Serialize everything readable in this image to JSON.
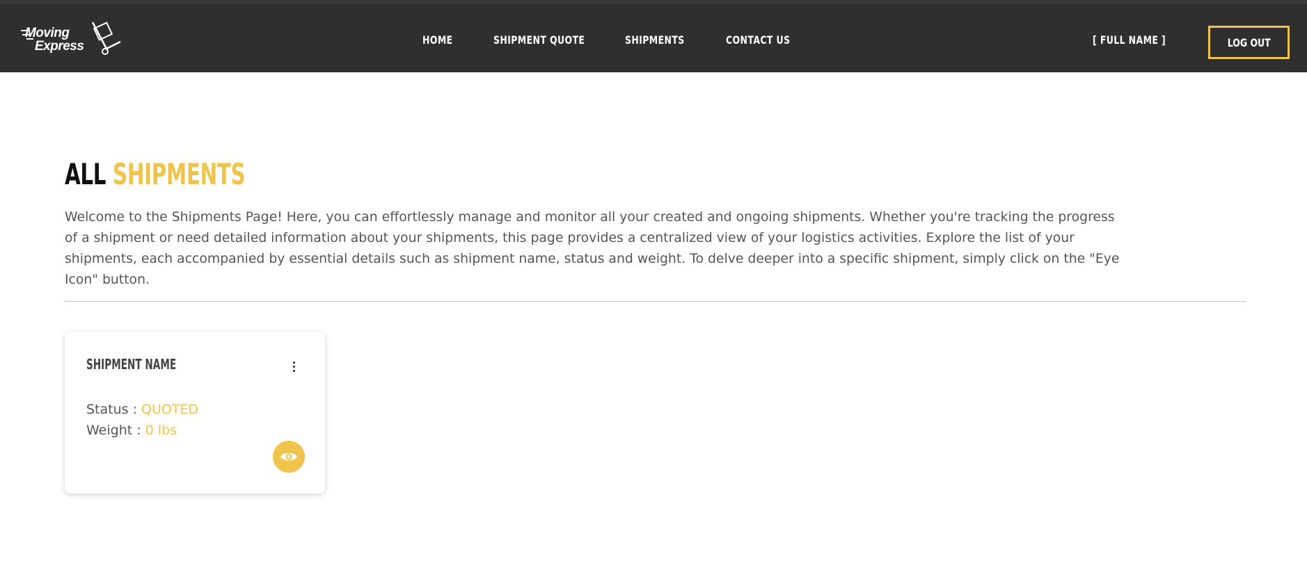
{
  "header": {
    "logo": {
      "line1": "Moving",
      "line2": "Express"
    },
    "nav": [
      {
        "label": "HOME"
      },
      {
        "label": "SHIPMENT QUOTE"
      },
      {
        "label": "SHIPMENTS"
      },
      {
        "label": "CONTACT US"
      }
    ],
    "user_name": "[ FULL NAME ]",
    "logout_label": "LOG OUT"
  },
  "main": {
    "title_word1": "ALL",
    "title_word2": "SHIPMENTS",
    "intro": "Welcome to the Shipments Page! Here, you can effortlessly manage and monitor all your created and ongoing shipments. Whether you're tracking the progress of a shipment or need detailed information about your shipments, this page provides a centralized view of your logistics activities. Explore the list of your shipments, each accompanied by essential details such as shipment name, status and weight. To delve deeper into a specific shipment, simply click on the \"Eye Icon\" button.",
    "shipments": [
      {
        "name": "SHIPMENT NAME",
        "status_label": "Status : ",
        "status_value": "QUOTED",
        "weight_label": "Weight : ",
        "weight_value": "0 lbs"
      }
    ]
  },
  "colors": {
    "accent": "#f0c44c",
    "header_bg": "#2f2f2f",
    "text": "#555555"
  },
  "icons": {
    "logo": "hand-truck-icon",
    "menu": "more-vertical-icon",
    "view": "eye-icon"
  }
}
